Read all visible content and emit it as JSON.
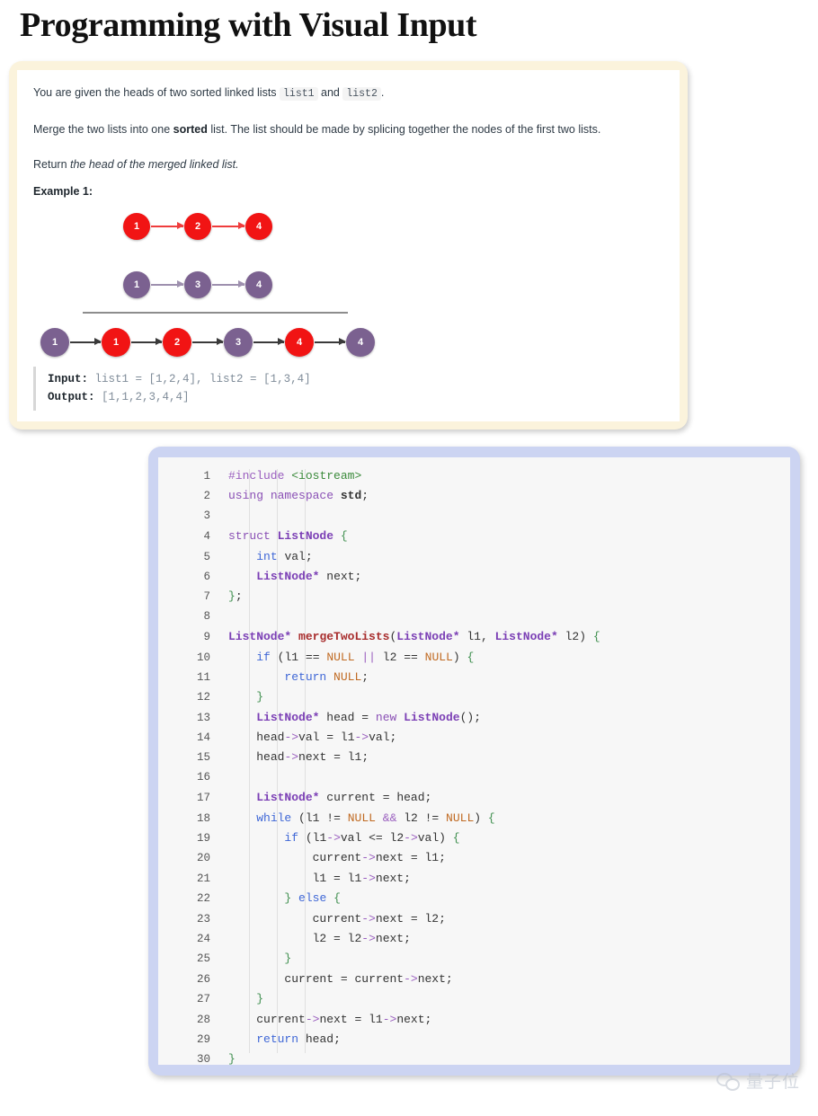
{
  "page": {
    "title": "Programming with Visual Input"
  },
  "problem": {
    "paragraph1_pre": "You are given the heads of two sorted linked lists ",
    "paragraph1_code1": "list1",
    "paragraph1_mid": " and ",
    "paragraph1_code2": "list2",
    "paragraph1_post": ".",
    "paragraph2_pre": "Merge the two lists into one ",
    "paragraph2_bold": "sorted",
    "paragraph2_post": " list. The list should be made by splicing together the nodes of the first two lists.",
    "paragraph3_pre": "Return ",
    "paragraph3_italic": "the head of the merged linked list.",
    "example_label": "Example 1:",
    "input_label": "Input:",
    "input_value": "list1 = [1,2,4], list2 = [1,3,4]",
    "output_label": "Output:",
    "output_value": "[1,1,2,3,4,4]"
  },
  "diagram": {
    "list1": {
      "color": "#f11414",
      "arrow_color": "#ef3d3d",
      "nodes": [
        "1",
        "2",
        "4"
      ]
    },
    "list2": {
      "color": "#7b6190",
      "arrow_color": "#9e90ae",
      "nodes": [
        "1",
        "3",
        "4"
      ]
    },
    "merged": {
      "arrow_color": "#3a3a3a",
      "nodes": [
        {
          "value": "1",
          "color": "purple"
        },
        {
          "value": "1",
          "color": "red"
        },
        {
          "value": "2",
          "color": "red"
        },
        {
          "value": "3",
          "color": "purple"
        },
        {
          "value": "4",
          "color": "red"
        },
        {
          "value": "4",
          "color": "purple"
        }
      ]
    }
  },
  "code": {
    "language": "cpp",
    "line_numbers": [
      "1",
      "2",
      "3",
      "4",
      "5",
      "6",
      "7",
      "8",
      "9",
      "10",
      "11",
      "12",
      "13",
      "14",
      "15",
      "16",
      "17",
      "18",
      "19",
      "20",
      "21",
      "22",
      "23",
      "24",
      "25",
      "26",
      "27",
      "28",
      "29",
      "30"
    ],
    "lines": [
      "#include <iostream>",
      "using namespace std;",
      "",
      "struct ListNode {",
      "    int val;",
      "    ListNode* next;",
      "};",
      "",
      "ListNode* mergeTwoLists(ListNode* l1, ListNode* l2) {",
      "    if (l1 == NULL || l2 == NULL) {",
      "        return NULL;",
      "    }",
      "    ListNode* head = new ListNode();",
      "    head->val = l1->val;",
      "    head->next = l1;",
      "",
      "    ListNode* current = head;",
      "    while (l1 != NULL && l2 != NULL) {",
      "        if (l1->val <= l2->val) {",
      "            current->next = l1;",
      "            l1 = l1->next;",
      "        } else {",
      "            current->next = l2;",
      "            l2 = l2->next;",
      "        }",
      "        current = current->next;",
      "    }",
      "    current->next = l1->next;",
      "    return head;",
      "}"
    ]
  },
  "watermark": {
    "text": "量子位",
    "icon": "wechat-icon"
  },
  "colors": {
    "problem_card_border": "#fbf3dc",
    "code_card_border": "#ccd4f2",
    "code_background": "#f7f7f7",
    "node_red": "#f11414",
    "node_purple": "#7b6190"
  }
}
